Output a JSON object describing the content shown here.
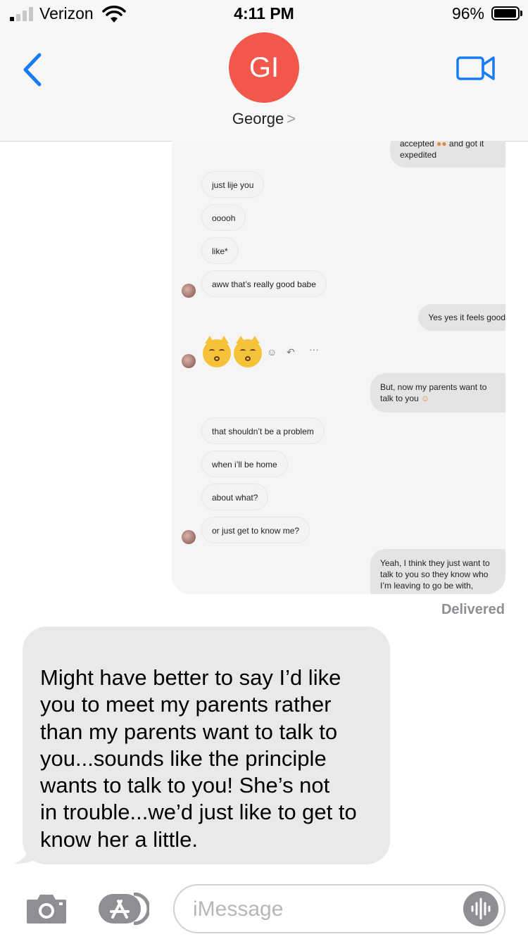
{
  "status_bar": {
    "carrier": "Verizon",
    "time": "4:11 PM",
    "battery_percent": "96%",
    "signal_bars_active": 1
  },
  "header": {
    "back_icon": "chevron-left-icon",
    "avatar_initials": "GI",
    "avatar_color": "#f2574c",
    "contact_name": "George",
    "contact_chevron": ">",
    "video_icon": "video-camera-icon",
    "accent_color": "#1a7cf5"
  },
  "shared_screenshot": {
    "messages": [
      {
        "from": "them",
        "text": "just lije you"
      },
      {
        "from": "them",
        "text": "ooooh"
      },
      {
        "from": "them",
        "text": "like*"
      },
      {
        "from": "them",
        "text": "aww that’s really good babe"
      },
      {
        "from": "me",
        "text": "Yes yes it feels good"
      },
      {
        "from": "them",
        "emoji": "kissing-cat-face x2"
      },
      {
        "from": "me",
        "text": "But, now my parents want to talk to you"
      },
      {
        "from": "them",
        "text": "that shouldn’t be a problem"
      },
      {
        "from": "them",
        "text": "when i’ll be home"
      },
      {
        "from": "them",
        "text": "about what?"
      },
      {
        "from": "them",
        "text": "or just get to know me?"
      },
      {
        "from": "me",
        "text": "Yeah, I think they just want to talk to you so they know who I’m leaving to go be with,"
      }
    ],
    "top_partial": {
      "line1": "accepted",
      "line1_tail": "and got it",
      "line2": "expedited"
    },
    "reaction_icons": [
      "smile-icon",
      "reply-icon",
      "more-icon"
    ],
    "out_lines": {
      "b1": [
        "But, now my parents want to",
        "talk to you"
      ],
      "b2": [
        "Yeah, I think they just want to",
        "talk to you so they know who",
        "I’m leaving to go be with,"
      ]
    }
  },
  "delivered_label": "Delivered",
  "incoming_bubble": {
    "lines": [
      "Might have better to say I’d like",
      "you to meet my parents rather",
      "than my parents want to talk to",
      "you...sounds like the principle",
      "wants to talk to you!  She’s not",
      "in trouble...we’d just like to get to",
      "know her a little."
    ]
  },
  "input_bar": {
    "camera_icon": "camera-icon",
    "apps_icon": "app-store-icon",
    "placeholder": "iMessage",
    "audio_icon": "audio-waveform-icon"
  }
}
